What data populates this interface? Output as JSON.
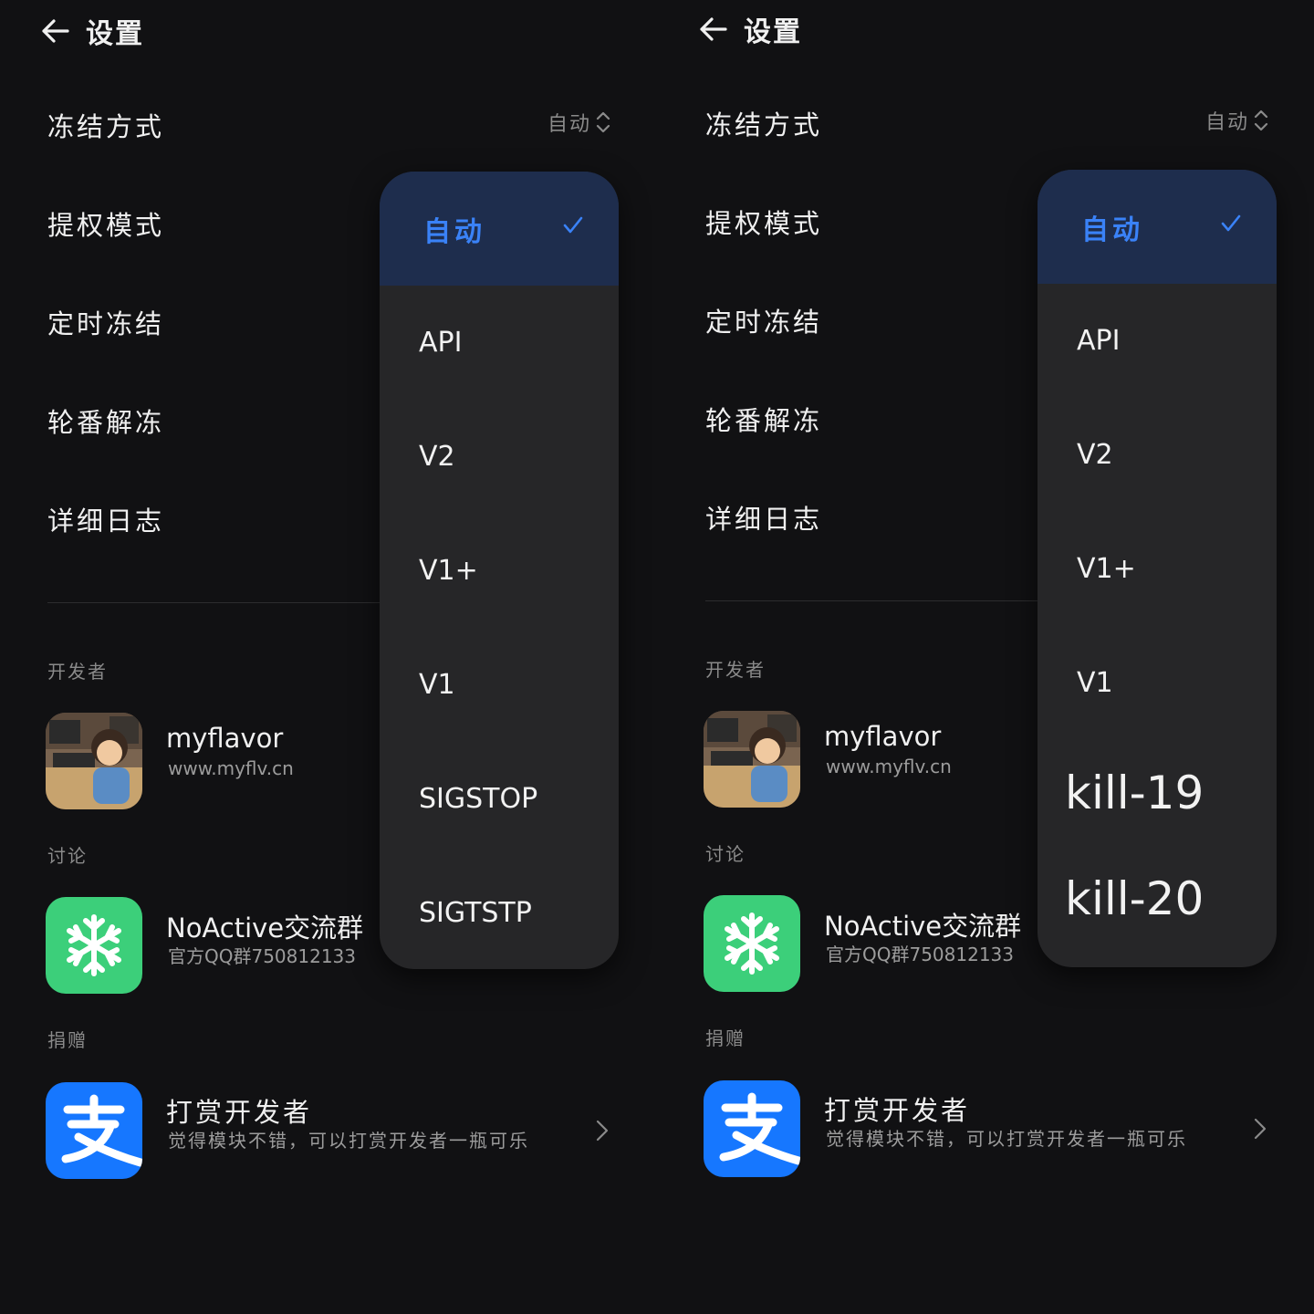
{
  "colors": {
    "background": "#111113",
    "dropdown": "#262628",
    "selected_bg": "#1e2d4d",
    "accent": "#3a82f7",
    "freeze_green": "#3ccf7a",
    "alipay_blue": "#1677ff"
  },
  "panels": [
    {
      "header": {
        "title": "设置",
        "back_icon": "arrow-left-icon"
      },
      "settings": [
        {
          "label": "冻结方式",
          "value": "自动"
        },
        {
          "label": "提权模式"
        },
        {
          "label": "定时冻结"
        },
        {
          "label": "轮番解冻"
        },
        {
          "label": "详细日志"
        }
      ],
      "sections": {
        "developer": {
          "label": "开发者",
          "name": "myflavor",
          "url": "www.myflv.cn"
        },
        "discussion": {
          "label": "讨论",
          "name": "NoActive交流群",
          "sub": "官方QQ群750812133"
        },
        "donate": {
          "label": "捐赠",
          "name": "打赏开发者",
          "sub": "觉得模块不错，可以打赏开发者一瓶可乐"
        }
      },
      "dropdown": {
        "selected": "自动",
        "options": [
          "自动",
          "API",
          "V2",
          "V1+",
          "V1",
          "SIGSTOP",
          "SIGTSTP"
        ]
      }
    },
    {
      "header": {
        "title": "设置",
        "back_icon": "arrow-left-icon"
      },
      "settings": [
        {
          "label": "冻结方式",
          "value": "自动"
        },
        {
          "label": "提权模式"
        },
        {
          "label": "定时冻结"
        },
        {
          "label": "轮番解冻"
        },
        {
          "label": "详细日志"
        }
      ],
      "sections": {
        "developer": {
          "label": "开发者",
          "name": "myflavor",
          "url": "www.myflv.cn"
        },
        "discussion": {
          "label": "讨论",
          "name": "NoActive交流群",
          "sub": "官方QQ群750812133"
        },
        "donate": {
          "label": "捐赠",
          "name": "打赏开发者",
          "sub": "觉得模块不错，可以打赏开发者一瓶可乐"
        }
      },
      "dropdown": {
        "selected": "自动",
        "options": [
          "自动",
          "API",
          "V2",
          "V1+",
          "V1",
          "kill-19",
          "kill-20"
        ]
      }
    }
  ]
}
